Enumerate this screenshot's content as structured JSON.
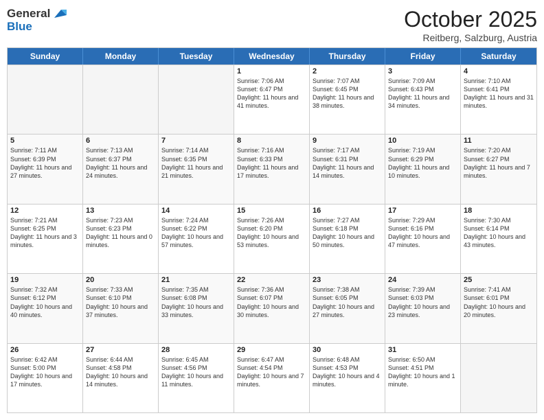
{
  "logo": {
    "general": "General",
    "blue": "Blue"
  },
  "header": {
    "month": "October 2025",
    "location": "Reitberg, Salzburg, Austria"
  },
  "days": [
    "Sunday",
    "Monday",
    "Tuesday",
    "Wednesday",
    "Thursday",
    "Friday",
    "Saturday"
  ],
  "weeks": [
    [
      {
        "day": "",
        "empty": true
      },
      {
        "day": "",
        "empty": true
      },
      {
        "day": "",
        "empty": true
      },
      {
        "day": "1",
        "sunrise": "7:06 AM",
        "sunset": "6:47 PM",
        "daylight": "11 hours and 41 minutes."
      },
      {
        "day": "2",
        "sunrise": "7:07 AM",
        "sunset": "6:45 PM",
        "daylight": "11 hours and 38 minutes."
      },
      {
        "day": "3",
        "sunrise": "7:09 AM",
        "sunset": "6:43 PM",
        "daylight": "11 hours and 34 minutes."
      },
      {
        "day": "4",
        "sunrise": "7:10 AM",
        "sunset": "6:41 PM",
        "daylight": "11 hours and 31 minutes."
      }
    ],
    [
      {
        "day": "5",
        "sunrise": "7:11 AM",
        "sunset": "6:39 PM",
        "daylight": "11 hours and 27 minutes."
      },
      {
        "day": "6",
        "sunrise": "7:13 AM",
        "sunset": "6:37 PM",
        "daylight": "11 hours and 24 minutes."
      },
      {
        "day": "7",
        "sunrise": "7:14 AM",
        "sunset": "6:35 PM",
        "daylight": "11 hours and 21 minutes."
      },
      {
        "day": "8",
        "sunrise": "7:16 AM",
        "sunset": "6:33 PM",
        "daylight": "11 hours and 17 minutes."
      },
      {
        "day": "9",
        "sunrise": "7:17 AM",
        "sunset": "6:31 PM",
        "daylight": "11 hours and 14 minutes."
      },
      {
        "day": "10",
        "sunrise": "7:19 AM",
        "sunset": "6:29 PM",
        "daylight": "11 hours and 10 minutes."
      },
      {
        "day": "11",
        "sunrise": "7:20 AM",
        "sunset": "6:27 PM",
        "daylight": "11 hours and 7 minutes."
      }
    ],
    [
      {
        "day": "12",
        "sunrise": "7:21 AM",
        "sunset": "6:25 PM",
        "daylight": "11 hours and 3 minutes."
      },
      {
        "day": "13",
        "sunrise": "7:23 AM",
        "sunset": "6:23 PM",
        "daylight": "11 hours and 0 minutes."
      },
      {
        "day": "14",
        "sunrise": "7:24 AM",
        "sunset": "6:22 PM",
        "daylight": "10 hours and 57 minutes."
      },
      {
        "day": "15",
        "sunrise": "7:26 AM",
        "sunset": "6:20 PM",
        "daylight": "10 hours and 53 minutes."
      },
      {
        "day": "16",
        "sunrise": "7:27 AM",
        "sunset": "6:18 PM",
        "daylight": "10 hours and 50 minutes."
      },
      {
        "day": "17",
        "sunrise": "7:29 AM",
        "sunset": "6:16 PM",
        "daylight": "10 hours and 47 minutes."
      },
      {
        "day": "18",
        "sunrise": "7:30 AM",
        "sunset": "6:14 PM",
        "daylight": "10 hours and 43 minutes."
      }
    ],
    [
      {
        "day": "19",
        "sunrise": "7:32 AM",
        "sunset": "6:12 PM",
        "daylight": "10 hours and 40 minutes."
      },
      {
        "day": "20",
        "sunrise": "7:33 AM",
        "sunset": "6:10 PM",
        "daylight": "10 hours and 37 minutes."
      },
      {
        "day": "21",
        "sunrise": "7:35 AM",
        "sunset": "6:08 PM",
        "daylight": "10 hours and 33 minutes."
      },
      {
        "day": "22",
        "sunrise": "7:36 AM",
        "sunset": "6:07 PM",
        "daylight": "10 hours and 30 minutes."
      },
      {
        "day": "23",
        "sunrise": "7:38 AM",
        "sunset": "6:05 PM",
        "daylight": "10 hours and 27 minutes."
      },
      {
        "day": "24",
        "sunrise": "7:39 AM",
        "sunset": "6:03 PM",
        "daylight": "10 hours and 23 minutes."
      },
      {
        "day": "25",
        "sunrise": "7:41 AM",
        "sunset": "6:01 PM",
        "daylight": "10 hours and 20 minutes."
      }
    ],
    [
      {
        "day": "26",
        "sunrise": "6:42 AM",
        "sunset": "5:00 PM",
        "daylight": "10 hours and 17 minutes."
      },
      {
        "day": "27",
        "sunrise": "6:44 AM",
        "sunset": "4:58 PM",
        "daylight": "10 hours and 14 minutes."
      },
      {
        "day": "28",
        "sunrise": "6:45 AM",
        "sunset": "4:56 PM",
        "daylight": "10 hours and 11 minutes."
      },
      {
        "day": "29",
        "sunrise": "6:47 AM",
        "sunset": "4:54 PM",
        "daylight": "10 hours and 7 minutes."
      },
      {
        "day": "30",
        "sunrise": "6:48 AM",
        "sunset": "4:53 PM",
        "daylight": "10 hours and 4 minutes."
      },
      {
        "day": "31",
        "sunrise": "6:50 AM",
        "sunset": "4:51 PM",
        "daylight": "10 hours and 1 minute."
      },
      {
        "day": "",
        "empty": true
      }
    ]
  ]
}
